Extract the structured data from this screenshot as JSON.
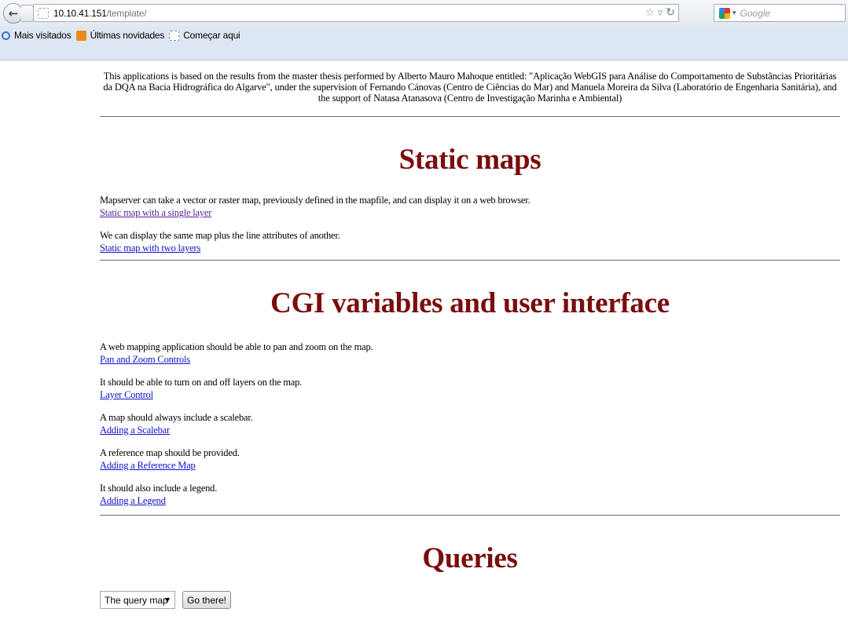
{
  "browser": {
    "url_host": "10.10.41.151",
    "url_path": "/template/",
    "search_placeholder": "Google",
    "bookmarks": [
      "Mais visitados",
      "Últimas novidades",
      "Começar aqui"
    ]
  },
  "intro": "This applications is based on the results from the master thesis performed by Alberto Mauro Mahoque entitled: \"Aplicação WebGIS para Análise do Comportamento de Substâncias Prioritárias da DQA na Bacia Hidrográfica do Algarve\", under the supervision of Fernando Cánovas (Centro de Ciências do Mar) and Manuela Moreira da Silva (Laboratório de Engenharia Sanitária), and the support of Natasa Atanasova (Centro de Investigação Marinha e Ambiental)",
  "static_maps": {
    "title": "Static maps",
    "items": [
      {
        "desc": "Mapserver can take a vector or raster map, previously defined in the mapfile, and can display it on a web browser.",
        "link": "Static map with a single layer"
      },
      {
        "desc": "We can display the same map plus the line attributes of another.",
        "link": "Static map with two layers"
      }
    ]
  },
  "cgi": {
    "title": "CGI variables and user interface",
    "items": [
      {
        "desc": "A web mapping application should be able to pan and zoom on the map.",
        "link": "Pan and Zoom Controls"
      },
      {
        "desc": "It should be able to turn on and off layers on the map.",
        "link": "Layer Control"
      },
      {
        "desc": "A map should always include a scalebar.",
        "link": "Adding a Scalebar"
      },
      {
        "desc": "A reference map should be provided.",
        "link": "Adding a Reference Map"
      },
      {
        "desc": "It should also include a legend.",
        "link": "Adding a Legend"
      }
    ]
  },
  "queries": {
    "title": "Queries",
    "select_value": "The query map",
    "button_label": "Go there!"
  },
  "colors": {
    "heading": "#7a0d0d",
    "link": "#1111cc",
    "visited_link": "#5b1f9a"
  }
}
